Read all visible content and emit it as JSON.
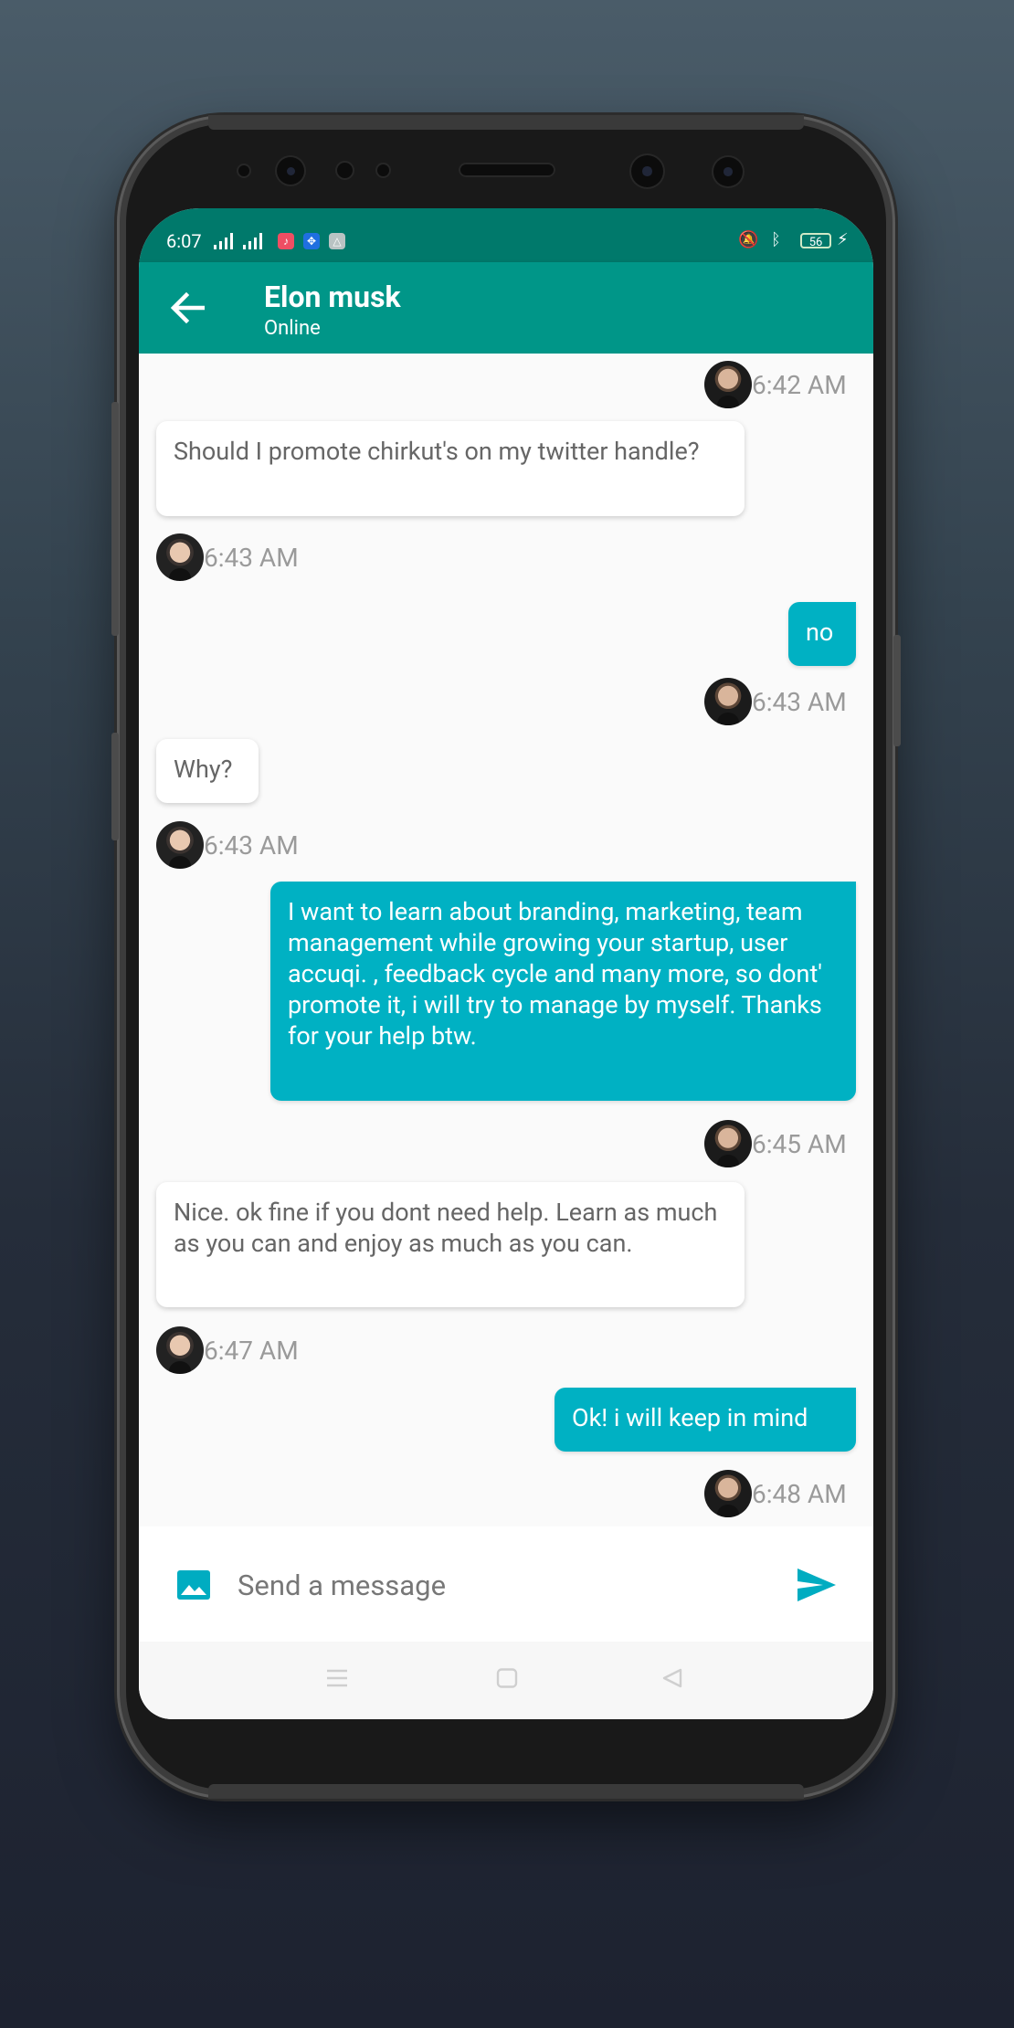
{
  "status_bar": {
    "time": "6:07",
    "battery": "56"
  },
  "header": {
    "contact_name": "Elon musk",
    "status": "Online"
  },
  "messages": [
    {
      "side": "out",
      "text": "",
      "time": "6:42 AM"
    },
    {
      "side": "in",
      "text": "Should I promote chirkut's on my twitter handle?",
      "time": "6:43 AM"
    },
    {
      "side": "out",
      "text": "no",
      "time": "6:43 AM"
    },
    {
      "side": "in",
      "text": "Why?",
      "time": "6:43 AM"
    },
    {
      "side": "out",
      "text": "I want to learn about branding, marketing, team management while growing your startup, user accuqi. , feedback cycle and many more, so dont' promote it, i will try to manage by myself. Thanks for your help btw.",
      "time": "6:45 AM"
    },
    {
      "side": "in",
      "text": "Nice. ok fine if you dont need help. Learn as much as you can and enjoy as much as you can.",
      "time": "6:47 AM"
    },
    {
      "side": "out",
      "text": "Ok! i will keep in mind",
      "time": "6:48 AM"
    }
  ],
  "composer": {
    "placeholder": "Send a message"
  },
  "colors": {
    "status_bar": "#00796b",
    "app_bar": "#009688",
    "outgoing_bubble": "#00b1c3",
    "incoming_bubble": "#ffffff",
    "accent": "#00acc1"
  },
  "icons": {
    "back": "arrow-left-icon",
    "attach": "image-icon",
    "send": "send-icon",
    "nav_menu": "menu-icon",
    "nav_home": "square-icon",
    "nav_back": "triangle-back-icon"
  }
}
